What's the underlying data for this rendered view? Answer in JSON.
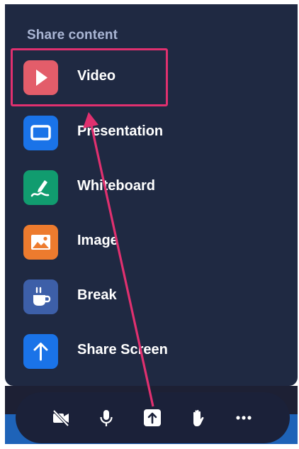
{
  "menu": {
    "heading": "Share content",
    "items": [
      {
        "label": "Video",
        "icon": "play-icon",
        "color": "#e35d6a"
      },
      {
        "label": "Presentation",
        "icon": "presentation-icon",
        "color": "#1a73e8"
      },
      {
        "label": "Whiteboard",
        "icon": "whiteboard-pen-icon",
        "color": "#119c6f"
      },
      {
        "label": "Image",
        "icon": "image-icon",
        "color": "#ed7b2e"
      },
      {
        "label": "Break",
        "icon": "coffee-cup-icon",
        "color": "#3d5fa8"
      },
      {
        "label": "Share Screen",
        "icon": "upload-arrow-icon",
        "color": "#1a73e8"
      }
    ]
  },
  "toolbar": {
    "buttons": [
      {
        "icon": "camera-off-icon"
      },
      {
        "icon": "microphone-icon"
      },
      {
        "icon": "share-content-icon"
      },
      {
        "icon": "raise-hand-icon"
      },
      {
        "icon": "more-options-icon"
      }
    ]
  },
  "annotation": {
    "highlight_color": "#e0306f",
    "arrow_color": "#e0306f"
  }
}
